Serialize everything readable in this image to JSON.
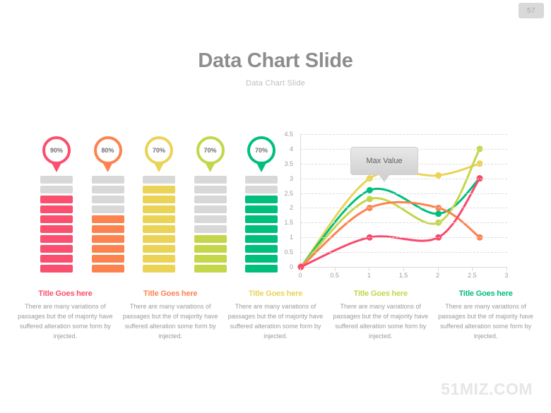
{
  "page": {
    "number": "57"
  },
  "header": {
    "title": "Data Chart Slide",
    "subtitle": "Data Chart Slide"
  },
  "watermark": "51MIZ.COM",
  "colors": {
    "red": "#fa4f६e",
    "series_red": "#f9496d",
    "series_orange": "#fc8350",
    "series_yellow": "#ead355",
    "series_lime": "#c4d64a",
    "series_teal": "#00bf7d",
    "empty_segment": "#d8d8d8",
    "title_gray": "#8d8d8d",
    "subtitle_gray": "#bdbdbd"
  },
  "columns": [
    {
      "pin_label": "90%",
      "color": "#fa4f6e",
      "total_segments": 10,
      "filled_segments": 8
    },
    {
      "pin_label": "80%",
      "color": "#fc8350",
      "total_segments": 10,
      "filled_segments": 6
    },
    {
      "pin_label": "70%",
      "color": "#ead355",
      "total_segments": 10,
      "filled_segments": 9
    },
    {
      "pin_label": "70%",
      "color": "#c4d64a",
      "total_segments": 10,
      "filled_segments": 4
    },
    {
      "pin_label": "70%",
      "color": "#00bf7d",
      "total_segments": 10,
      "filled_segments": 8
    }
  ],
  "captions": [
    {
      "title": "Title Goes here",
      "color": "#fa4f6e",
      "body": "There are many variations of passages but the of majority have suffered alteration some form by injected."
    },
    {
      "title": "Title Goes here",
      "color": "#fc8350",
      "body": "There are many variations of passages but the of majority have suffered alteration some form by injected."
    },
    {
      "title": "Title Goes here",
      "color": "#ead355",
      "body": "There are many variations of passages but the of majority have suffered alteration some form by injected."
    },
    {
      "title": "Title Goes here",
      "color": "#c4d64a",
      "body": "There are many variations of passages but the of majority have suffered alteration some form by injected."
    },
    {
      "title": "Title Goes here",
      "color": "#00bf7d",
      "body": "There are many variations of passages but the of majority have suffered alteration some form by injected."
    }
  ],
  "annotation": {
    "label": "Max Value"
  },
  "chart_data": {
    "type": "line",
    "title": "",
    "xlabel": "",
    "ylabel": "",
    "xlim": [
      0,
      3
    ],
    "ylim": [
      0,
      4.5
    ],
    "xticks": [
      "0",
      "0.5",
      "1",
      "1.5",
      "2",
      "2.5",
      "3"
    ],
    "yticks": [
      "0",
      "0.5",
      "1",
      "1.5",
      "2",
      "2.5",
      "3",
      "3.5",
      "4",
      "4.5"
    ],
    "grid": true,
    "legend": "none",
    "x": [
      0,
      1,
      2,
      2.6
    ],
    "series": [
      {
        "name": "Yellow",
        "color": "#ead355",
        "values": [
          0,
          3.0,
          3.1,
          3.5
        ]
      },
      {
        "name": "Teal",
        "color": "#00bf7d",
        "values": [
          0,
          2.6,
          1.8,
          3.0
        ]
      },
      {
        "name": "Lime",
        "color": "#c4d64a",
        "values": [
          0,
          2.3,
          1.5,
          4.0
        ]
      },
      {
        "name": "Orange",
        "color": "#fc8350",
        "values": [
          0,
          2.0,
          2.0,
          1.0
        ]
      },
      {
        "name": "Red",
        "color": "#f9496d",
        "values": [
          0,
          1.0,
          1.0,
          3.0
        ]
      }
    ],
    "annotations": [
      {
        "text": "Max Value",
        "points_to_x": 1,
        "points_to_y": 3.0
      }
    ]
  }
}
